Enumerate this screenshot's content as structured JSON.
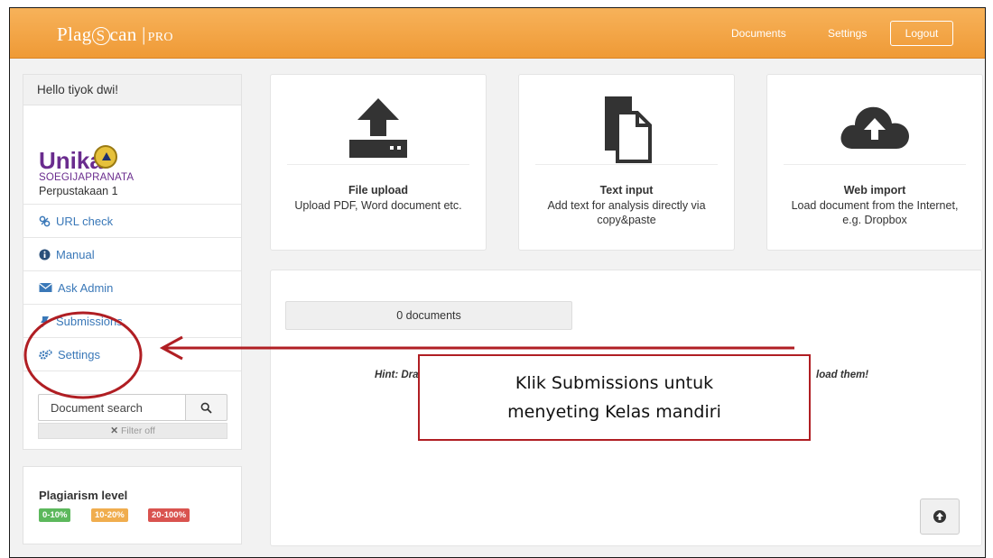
{
  "app": {
    "logo_main": "Plag",
    "logo_s": "S",
    "logo_rest": "can",
    "logo_sep": "|",
    "logo_pro": "PRO"
  },
  "nav": {
    "documents": "Documents",
    "settings": "Settings",
    "logout": "Logout"
  },
  "sidebar": {
    "greeting": "Hello tiyok dwi!",
    "org_logo_text": "Unika",
    "org_subtitle": "SOEGIJAPRANATA",
    "org_name": "Perpustakaan 1",
    "items": [
      {
        "label": "URL check",
        "icon": "link-icon"
      },
      {
        "label": "Manual",
        "icon": "info-icon"
      },
      {
        "label": "Ask Admin",
        "icon": "envelope-icon"
      },
      {
        "label": "Submissions",
        "icon": "pin-icon"
      },
      {
        "label": "Settings",
        "icon": "gears-icon"
      }
    ],
    "search_placeholder": "Document search",
    "filter": "Filter off"
  },
  "plagiarism": {
    "title": "Plagiarism level",
    "levels": [
      {
        "label": "0-10%",
        "color": "#5cb85c"
      },
      {
        "label": "10-20%",
        "color": "#f0ad4e"
      },
      {
        "label": "20-100%",
        "color": "#d9534f"
      }
    ]
  },
  "cards": [
    {
      "title": "File upload",
      "desc": "Upload PDF, Word document etc.",
      "icon": "upload-icon"
    },
    {
      "title": "Text input",
      "desc": "Add text for analysis directly via copy&paste",
      "icon": "document-copy-icon"
    },
    {
      "title": "Web import",
      "desc": "Load document from the Internet, e.g. Dropbox",
      "icon": "cloud-upload-icon"
    }
  ],
  "documents": {
    "count": "0 documents",
    "hint_start": "Hint: Dra",
    "hint_end": "load them!"
  },
  "annotation": {
    "line1": "Klik Submissions untuk",
    "line2": "menyeting Kelas mandiri",
    "color": "#b01e23"
  }
}
